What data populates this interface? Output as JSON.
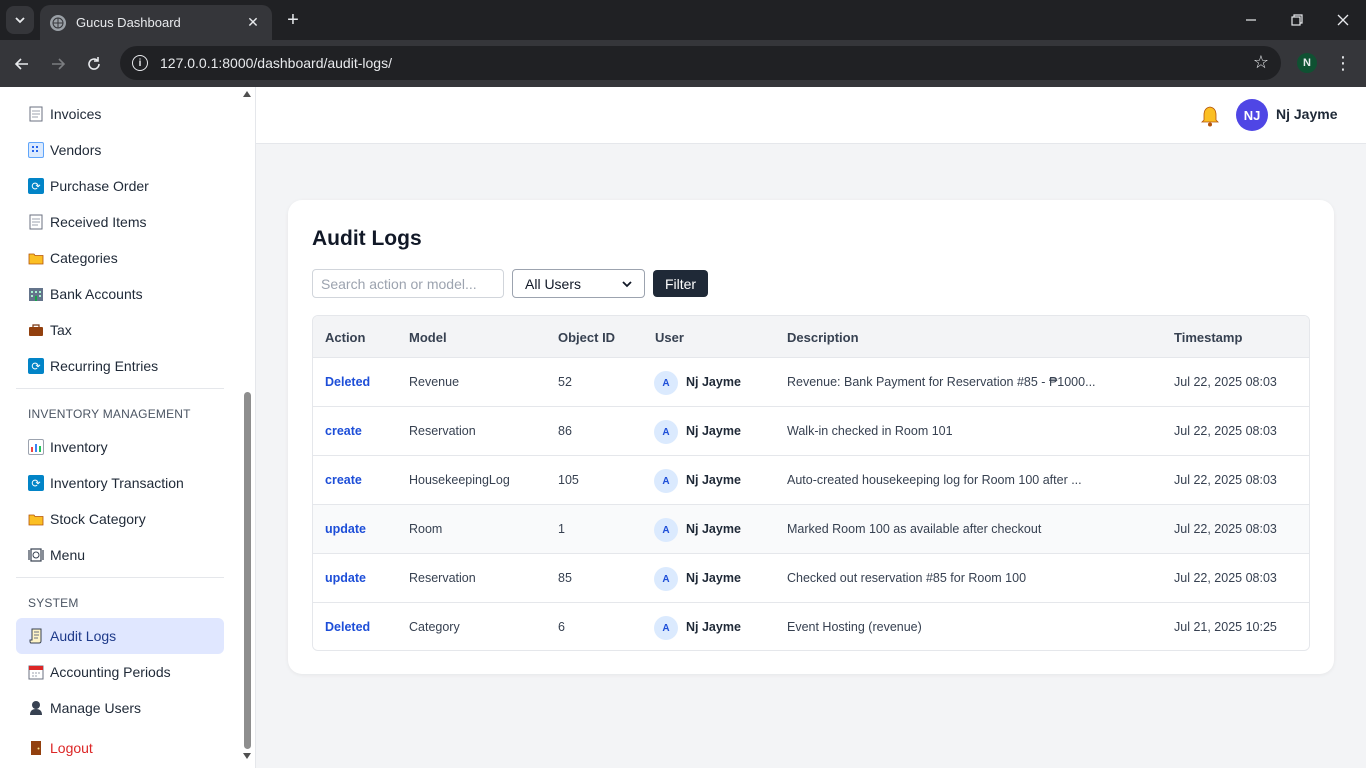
{
  "browser": {
    "tab_title": "Gucus Dashboard",
    "url": "127.0.0.1:8000/dashboard/audit-logs/",
    "profile_initial": "N"
  },
  "sidebar": {
    "items_top": [
      {
        "label": "Invoices",
        "icon": "document-icon"
      },
      {
        "label": "Vendors",
        "icon": "building-icon"
      },
      {
        "label": "Purchase Order",
        "icon": "cycle-icon"
      },
      {
        "label": "Received Items",
        "icon": "document-icon"
      },
      {
        "label": "Categories",
        "icon": "folder-icon"
      },
      {
        "label": "Bank Accounts",
        "icon": "bank-icon"
      },
      {
        "label": "Tax",
        "icon": "briefcase-icon"
      },
      {
        "label": "Recurring Entries",
        "icon": "cycle-icon"
      }
    ],
    "inventory_heading": "INVENTORY MANAGEMENT",
    "items_inventory": [
      {
        "label": "Inventory",
        "icon": "chart-icon"
      },
      {
        "label": "Inventory Transaction",
        "icon": "cycle-icon"
      },
      {
        "label": "Stock Category",
        "icon": "folder-icon"
      },
      {
        "label": "Menu",
        "icon": "plate-icon"
      }
    ],
    "system_heading": "SYSTEM",
    "items_system": [
      {
        "label": "Audit Logs",
        "icon": "scroll-icon"
      },
      {
        "label": "Accounting Periods",
        "icon": "calendar-icon"
      },
      {
        "label": "Manage Users",
        "icon": "user-icon"
      }
    ],
    "logout_label": "Logout"
  },
  "header": {
    "avatar_initials": "NJ",
    "user_name": "Nj Jayme"
  },
  "main": {
    "title": "Audit Logs",
    "search_placeholder": "Search action or model...",
    "user_filter_value": "All Users",
    "filter_button": "Filter",
    "columns": [
      "Action",
      "Model",
      "Object ID",
      "User",
      "Description",
      "Timestamp"
    ],
    "rows": [
      {
        "action": "Deleted",
        "model": "Revenue",
        "object_id": "52",
        "user_initial": "A",
        "user": "Nj Jayme",
        "description": "Revenue: Bank Payment for Reservation #85 - ₱1000...",
        "timestamp": "Jul 22, 2025 08:03"
      },
      {
        "action": "create",
        "model": "Reservation",
        "object_id": "86",
        "user_initial": "A",
        "user": "Nj Jayme",
        "description": "Walk-in checked in Room 101",
        "timestamp": "Jul 22, 2025 08:03"
      },
      {
        "action": "create",
        "model": "HousekeepingLog",
        "object_id": "105",
        "user_initial": "A",
        "user": "Nj Jayme",
        "description": "Auto-created housekeeping log for Room 100 after ...",
        "timestamp": "Jul 22, 2025 08:03"
      },
      {
        "action": "update",
        "model": "Room",
        "object_id": "1",
        "user_initial": "A",
        "user": "Nj Jayme",
        "description": "Marked Room 100 as available after checkout",
        "timestamp": "Jul 22, 2025 08:03"
      },
      {
        "action": "update",
        "model": "Reservation",
        "object_id": "85",
        "user_initial": "A",
        "user": "Nj Jayme",
        "description": "Checked out reservation #85 for Room 100",
        "timestamp": "Jul 22, 2025 08:03"
      },
      {
        "action": "Deleted",
        "model": "Category",
        "object_id": "6",
        "user_initial": "A",
        "user": "Nj Jayme",
        "description": "Event Hosting (revenue)",
        "timestamp": "Jul 21, 2025 10:25"
      }
    ]
  },
  "colors": {
    "accent": "#4f46e5",
    "action_link": "#1d4ed8",
    "active_nav_bg": "#e0e7ff",
    "logout": "#dc2626",
    "dark_button": "#1f2937"
  }
}
